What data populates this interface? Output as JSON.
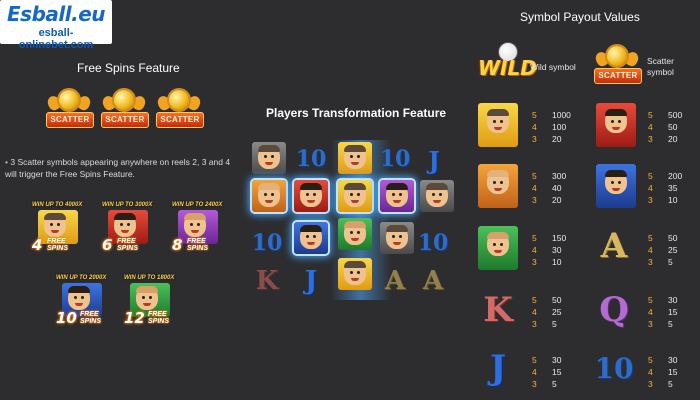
{
  "logo": {
    "brand": "Esball.eu",
    "site": "esball-onlinebet.com"
  },
  "free_spins": {
    "title": "Free Spins Feature",
    "scatter_label": "SCATTER",
    "description": "3 Scatter symbols appearing anywhere on reels 2, 3 and 4 will trigger the Free Spins Feature.",
    "tiles": [
      {
        "win": "WIN UP TO 4000X",
        "spins": "4",
        "word": "FREE SPINS"
      },
      {
        "win": "WIN UP TO 3000X",
        "spins": "6",
        "word": "FREE SPINS"
      },
      {
        "win": "WIN UP TO 2400X",
        "spins": "8",
        "word": "FREE SPINS"
      },
      {
        "win": "WIN UP TO 2000X",
        "spins": "10",
        "word": "FREE SPINS"
      },
      {
        "win": "WIN UP TO 1800X",
        "spins": "12",
        "word": "FREE SPINS"
      }
    ]
  },
  "transform": {
    "title": "Players Transformation Feature",
    "glyphs": {
      "ten": "10",
      "j": "J",
      "k": "K",
      "a": "A"
    }
  },
  "payouts": {
    "title": "Symbol Payout Values",
    "wild_label": "Wild symbol",
    "wild_text": "WILD",
    "scatter_label_line1": "Scatter",
    "scatter_label_line2": "symbol",
    "scatter_badge": "SCATTER",
    "counts": [
      "5",
      "4",
      "3"
    ],
    "items": [
      {
        "name": "player-1",
        "values": [
          "1000",
          "100",
          "20"
        ]
      },
      {
        "name": "player-2",
        "values": [
          "500",
          "50",
          "20"
        ]
      },
      {
        "name": "player-3",
        "values": [
          "300",
          "40",
          "20"
        ]
      },
      {
        "name": "player-4",
        "values": [
          "200",
          "35",
          "10"
        ]
      },
      {
        "name": "player-5",
        "values": [
          "150",
          "30",
          "10"
        ]
      },
      {
        "name": "A",
        "glyph": "A",
        "values": [
          "50",
          "25",
          "5"
        ]
      },
      {
        "name": "K",
        "glyph": "K",
        "values": [
          "50",
          "25",
          "5"
        ]
      },
      {
        "name": "Q",
        "glyph": "Q",
        "values": [
          "30",
          "15",
          "5"
        ]
      },
      {
        "name": "J",
        "glyph": "J",
        "values": [
          "30",
          "15",
          "5"
        ]
      },
      {
        "name": "10",
        "glyph": "10",
        "values": [
          "30",
          "15",
          "5"
        ]
      }
    ]
  }
}
